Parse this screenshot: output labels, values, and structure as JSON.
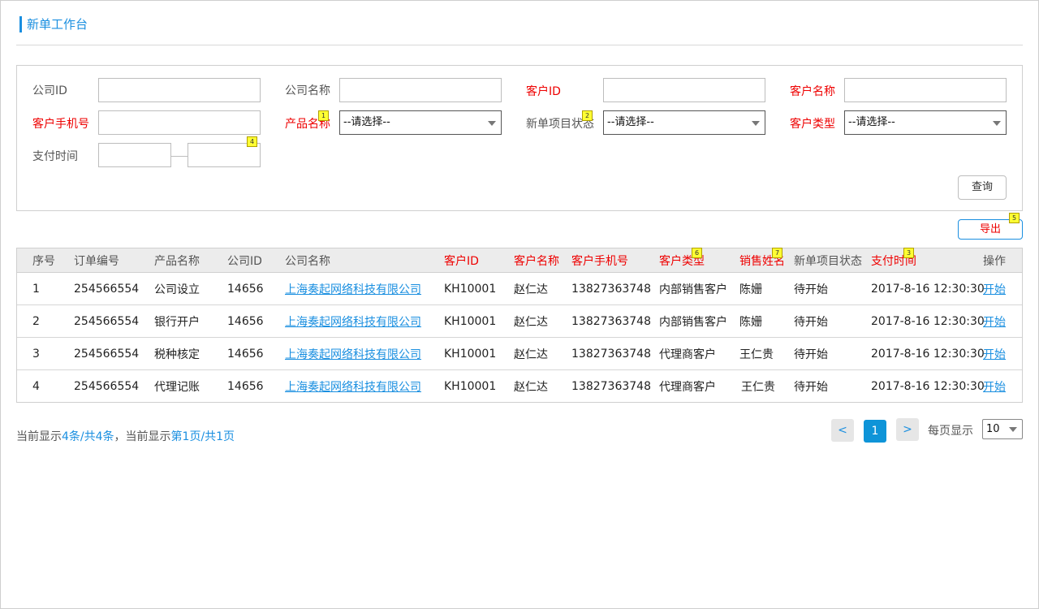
{
  "page": {
    "title": "新单工作台"
  },
  "filters": {
    "company_id_label": "公司ID",
    "company_name_label": "公司名称",
    "customer_id_label": "客户ID",
    "customer_name_label": "客户名称",
    "customer_phone_label": "客户手机号",
    "product_name_label": "产品名称",
    "project_status_label": "新单项目状态",
    "customer_type_label": "客户类型",
    "pay_time_label": "支付时间",
    "select_placeholder": "--请选择--",
    "query_button": "查询",
    "badges": {
      "product": "1",
      "status": "2",
      "pay_time": "4"
    }
  },
  "toolbar": {
    "export_button": "导出",
    "export_badge": "5"
  },
  "table": {
    "headers": {
      "seq": "序号",
      "order_no": "订单编号",
      "product": "产品名称",
      "company_id": "公司ID",
      "company_name": "公司名称",
      "customer_id": "客户ID",
      "customer_name": "客户名称",
      "phone": "客户手机号",
      "customer_type": "客户类型",
      "sales_name": "销售姓名",
      "status": "新单项目状态",
      "pay_time": "支付时间",
      "action": "操作"
    },
    "header_badges": {
      "customer_type": "6",
      "sales_name": "7",
      "pay_time": "3"
    },
    "rows": [
      {
        "seq": "1",
        "order_no": "254566554",
        "product": "公司设立",
        "company_id": "14656",
        "company_name": "上海奏起网络科技有限公司",
        "customer_id": "KH10001",
        "customer_name": "赵仁达",
        "phone": "13827363748",
        "customer_type": "内部销售客户",
        "sales_name": "陈姗",
        "status": "待开始",
        "pay_time": "2017-8-16 12:30:30",
        "action": "开始"
      },
      {
        "seq": "2",
        "order_no": "254566554",
        "product": "银行开户",
        "company_id": "14656",
        "company_name": "上海奏起网络科技有限公司",
        "customer_id": "KH10001",
        "customer_name": "赵仁达",
        "phone": "13827363748",
        "customer_type": "内部销售客户",
        "sales_name": "陈姗",
        "status": "待开始",
        "pay_time": "2017-8-16 12:30:30",
        "action": "开始"
      },
      {
        "seq": "3",
        "order_no": "254566554",
        "product": "税种核定",
        "company_id": "14656",
        "company_name": "上海奏起网络科技有限公司",
        "customer_id": "KH10001",
        "customer_name": "赵仁达",
        "phone": "13827363748",
        "customer_type": "代理商客户",
        "sales_name": "王仁贵",
        "status": "待开始",
        "pay_time": "2017-8-16 12:30:30",
        "action": "开始"
      },
      {
        "seq": "4",
        "order_no": "254566554",
        "product": "代理记账",
        "company_id": "14656",
        "company_name": "上海奏起网络科技有限公司",
        "customer_id": "KH10001",
        "customer_name": "赵仁达",
        "phone": "13827363748",
        "customer_type": "代理商客户",
        "sales_name": "王仁贵",
        "status": "待开始",
        "pay_time": "2017-8-16 12:30:30",
        "action": "开始"
      }
    ]
  },
  "pagination": {
    "info_prefix": "当前显示",
    "info_count": "4条/共4条",
    "info_mid": "，当前显示",
    "info_pages": "第1页/共1页",
    "prev": "<",
    "current": "1",
    "next": ">",
    "per_page_label": "每页显示",
    "per_page_value": "10"
  },
  "colors": {
    "accent": "#1a8fe0",
    "required": "#e00000",
    "badge": "#ffff33"
  }
}
